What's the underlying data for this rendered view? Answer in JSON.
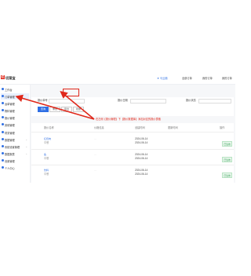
{
  "app": {
    "logo_mark": "红",
    "logo_text": "切菜宝"
  },
  "header": {
    "user": "▼ 马云霸",
    "links": [
      "全部订单",
      "我的订单",
      "我的订单"
    ]
  },
  "sidebar": {
    "items": [
      {
        "label": "工作台",
        "active": false
      },
      {
        "label": "订单管理",
        "active": true
      },
      {
        "label": "运单管理",
        "active": false
      },
      {
        "label": "物料管理",
        "active": false
      },
      {
        "label": "报价管理",
        "active": false
      },
      {
        "label": "其他管理",
        "active": false
      },
      {
        "label": "财务管理",
        "active": false
      },
      {
        "label": "数据管理",
        "active": false
      },
      {
        "label": "系统设置管理",
        "active": false
      },
      {
        "label": "数据报表",
        "active": false
      },
      {
        "label": "设置管理",
        "active": false
      },
      {
        "label": "个人中心",
        "active": false
      }
    ]
  },
  "tabs": [
    "报价数据库",
    "价格数据",
    "销售数据",
    "客户管理",
    "订单",
    "数据分析",
    "数据"
  ],
  "filters": {
    "row1_labels": [
      "报价单号",
      "报价日期",
      "报价状态"
    ],
    "row2_buttons": [
      "查询",
      "重置",
      "导出",
      "批量"
    ]
  },
  "annotation": "在左侧【报价管理】下【报价数据库】添加对应的报价表格",
  "table": {
    "headers": [
      "报价名称",
      "价格信息",
      "创建时间",
      "更新时间",
      "操作"
    ],
    "rows": [
      {
        "name": "红烧肉",
        "sub": "中餐",
        "price": "…",
        "created": "2024-06-14",
        "updated": "2024-06-14",
        "status": "已生效"
      },
      {
        "name": "鱼",
        "sub": "中餐",
        "price": "…",
        "created": "2024-06-14",
        "updated": "2024-06-14",
        "status": "已生效"
      },
      {
        "name": "饮料",
        "sub": "中餐",
        "price": "…",
        "created": "2024-06-14",
        "updated": "2024-06-14",
        "status": "已生效"
      }
    ]
  },
  "colors": {
    "accent": "#2f6fe4",
    "annotation": "#e0281b",
    "success": "#3aa05a"
  }
}
